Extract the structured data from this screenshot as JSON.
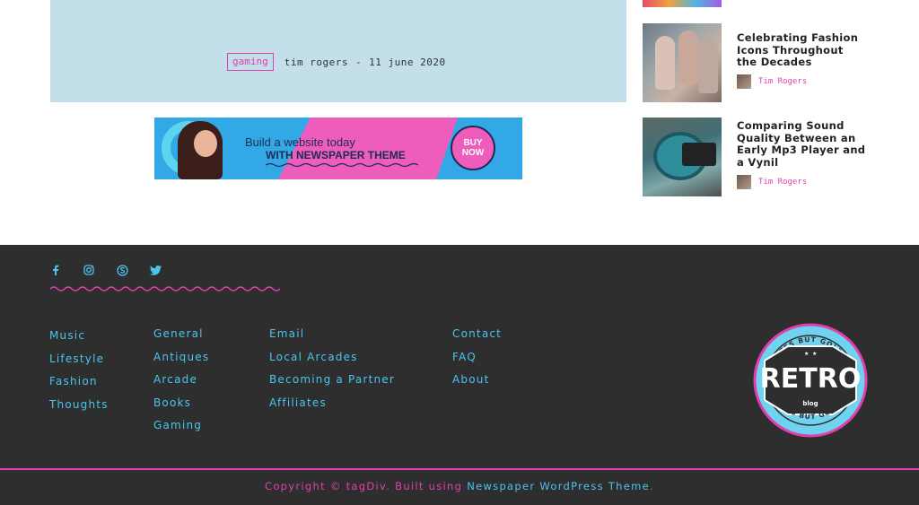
{
  "hero": {
    "category": "gaming",
    "author": "tim rogers",
    "separator": "-",
    "date": "11 june 2020"
  },
  "ad": {
    "line1": "Build a website today",
    "line2": "WITH NEWSPAPER THEME",
    "button_line1": "BUY",
    "button_line2": "NOW"
  },
  "sidebar": {
    "posts": [
      {
        "title": "Celebrating Fashion Icons Throughout the Decades",
        "author": "Tim Rogers"
      },
      {
        "title": "Comparing Sound Quality Between an Early Mp3 Player and a Vynil",
        "author": "Tim Rogers"
      }
    ]
  },
  "footer": {
    "socials": [
      "facebook-icon",
      "instagram-icon",
      "skype-icon",
      "twitter-icon"
    ],
    "columns": [
      [
        "Music",
        "Lifestyle",
        "Fashion",
        "Thoughts"
      ],
      [
        "General",
        "Antiques",
        "Arcade",
        "Books",
        "Gaming"
      ],
      [
        "Email",
        "Local Arcades",
        "Becoming a Partner",
        "Affiliates"
      ],
      [
        "Contact",
        "FAQ",
        "About"
      ]
    ],
    "logo": {
      "top_text": "BLATES BUT GOLDIES",
      "main": "RETRO",
      "sub": "blog",
      "bottom_text": "BLATES BUT GOLDIES"
    },
    "copyright_prefix": "Copyright © tagDiv. Built using ",
    "copyright_link": "Newspaper WordPress Theme",
    "copyright_suffix": "."
  },
  "colors": {
    "accent_pink": "#e23fae",
    "accent_blue": "#49c5f0",
    "footer_bg": "#2e2e2e",
    "hero_bg": "#c3dfe9"
  }
}
